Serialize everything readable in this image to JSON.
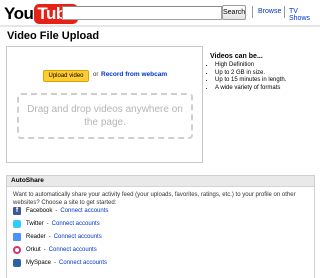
{
  "header": {
    "logo_you": "You",
    "logo_tube": "Tube",
    "search_value": "",
    "search_button": "Search",
    "nav": [
      "Browse",
      "TV Shows"
    ]
  },
  "page": {
    "title": "Video File Upload"
  },
  "upload": {
    "button_label": "Upload video",
    "or_text": "or",
    "record_label": "Record from webcam",
    "drop_text": "Drag and drop videos anywhere on the page."
  },
  "info": {
    "title": "Videos can be...",
    "items": [
      "High Definition",
      "Up to 2 GB in size.",
      "Up to 15 minutes in length.",
      "A wide variety of formats"
    ]
  },
  "autoshare": {
    "title": "AutoShare",
    "description": "Want to automatically share your activity feed (your uploads, favorites, ratings, etc.) to your profile on other websites? Choose a site to get started:",
    "sites": [
      {
        "name": "Facebook",
        "link": "Connect accounts",
        "icon": "facebook-icon",
        "color": "#3b5998"
      },
      {
        "name": "Twitter",
        "link": "Connect accounts",
        "icon": "twitter-icon",
        "color": "#33ccff"
      },
      {
        "name": "Reader",
        "link": "Connect accounts",
        "icon": "reader-icon",
        "color": "#4d90fe"
      },
      {
        "name": "Orkut",
        "link": "Connect accounts",
        "icon": "orkut-icon",
        "color": "#d6336c"
      },
      {
        "name": "MySpace",
        "link": "Connect accounts",
        "icon": "myspace-icon",
        "color": "#2b5fa8"
      }
    ]
  },
  "colors": {
    "brand_red": "#e62117",
    "link_blue": "#0033cc",
    "upload_yellow": "#ffcc33"
  }
}
